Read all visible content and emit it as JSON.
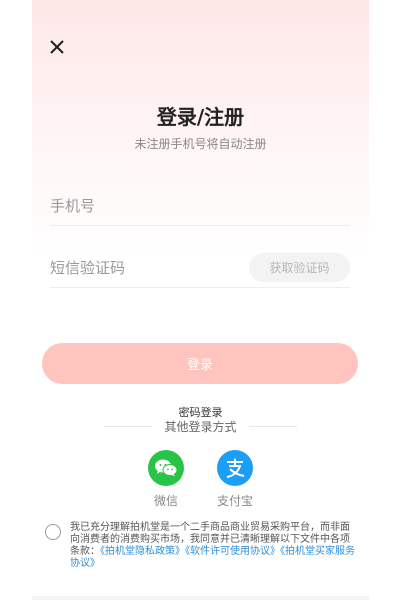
{
  "header": {
    "title": "登录/注册",
    "subtitle": "未注册手机号将自动注册"
  },
  "form": {
    "phone_placeholder": "手机号",
    "code_placeholder": "短信验证码",
    "get_code_label": "获取验证码",
    "login_label": "登录"
  },
  "alt": {
    "password_login": "密码登录",
    "other_methods": "其他登录方式",
    "methods": [
      {
        "label": "微信",
        "icon": "wechat-icon",
        "color": "#28c445"
      },
      {
        "label": "支付宝",
        "icon": "alipay-icon",
        "color": "#1c9ef5"
      }
    ]
  },
  "agreement": {
    "text": "我已充分理解拍机堂是一个二手商品商业贸易采购平台，而非面向消费者的消费购买市场，我同意并已清晰理解以下文件中各项条款：",
    "links": [
      "《拍机堂隐私政策》",
      "《软件许可使用协议》",
      "《拍机堂买家服务协议》"
    ]
  },
  "colors": {
    "accent": "#ffc4bd",
    "link": "#2d8ed8"
  }
}
